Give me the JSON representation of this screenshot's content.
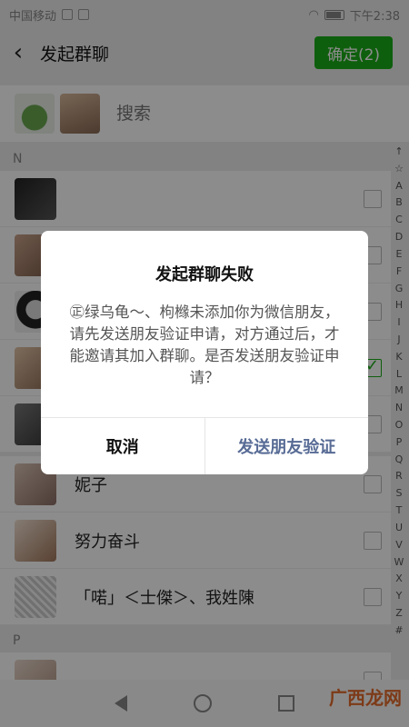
{
  "status_bar": {
    "carrier": "中国移动",
    "time": "下午2:38"
  },
  "nav": {
    "title": "发起群聊",
    "confirm_label": "确定(2)"
  },
  "search": {
    "placeholder": "搜索"
  },
  "sections": [
    {
      "letter": "N"
    },
    {
      "letter": "P"
    }
  ],
  "contacts": [
    {
      "name": "",
      "checked": false
    },
    {
      "name": "",
      "checked": false
    },
    {
      "name": "",
      "checked": false
    },
    {
      "name": "",
      "checked": true
    },
    {
      "name": "",
      "checked": false
    },
    {
      "name": "妮子",
      "checked": false
    },
    {
      "name": "努力奋斗",
      "checked": false
    },
    {
      "name": "「喏」＜士傑＞、我姓陳",
      "checked": false
    },
    {
      "name": "",
      "checked": false
    }
  ],
  "alphabet": [
    "↑",
    "☆",
    "A",
    "B",
    "C",
    "D",
    "E",
    "F",
    "G",
    "H",
    "I",
    "J",
    "K",
    "L",
    "M",
    "N",
    "O",
    "P",
    "Q",
    "R",
    "S",
    "T",
    "U",
    "V",
    "W",
    "X",
    "Y",
    "Z",
    "#"
  ],
  "dialog": {
    "title": "发起群聊失败",
    "message": "㊣绿乌龟～、枸橼未添加你为微信朋友，请先发送朋友验证申请，对方通过后，才能邀请其加入群聊。是否发送朋友验证申请？",
    "cancel_label": "取消",
    "send_label": "发送朋友验证"
  },
  "watermark": "广西龙网",
  "colors": {
    "accent": "#1aad19",
    "link": "#576b95"
  }
}
